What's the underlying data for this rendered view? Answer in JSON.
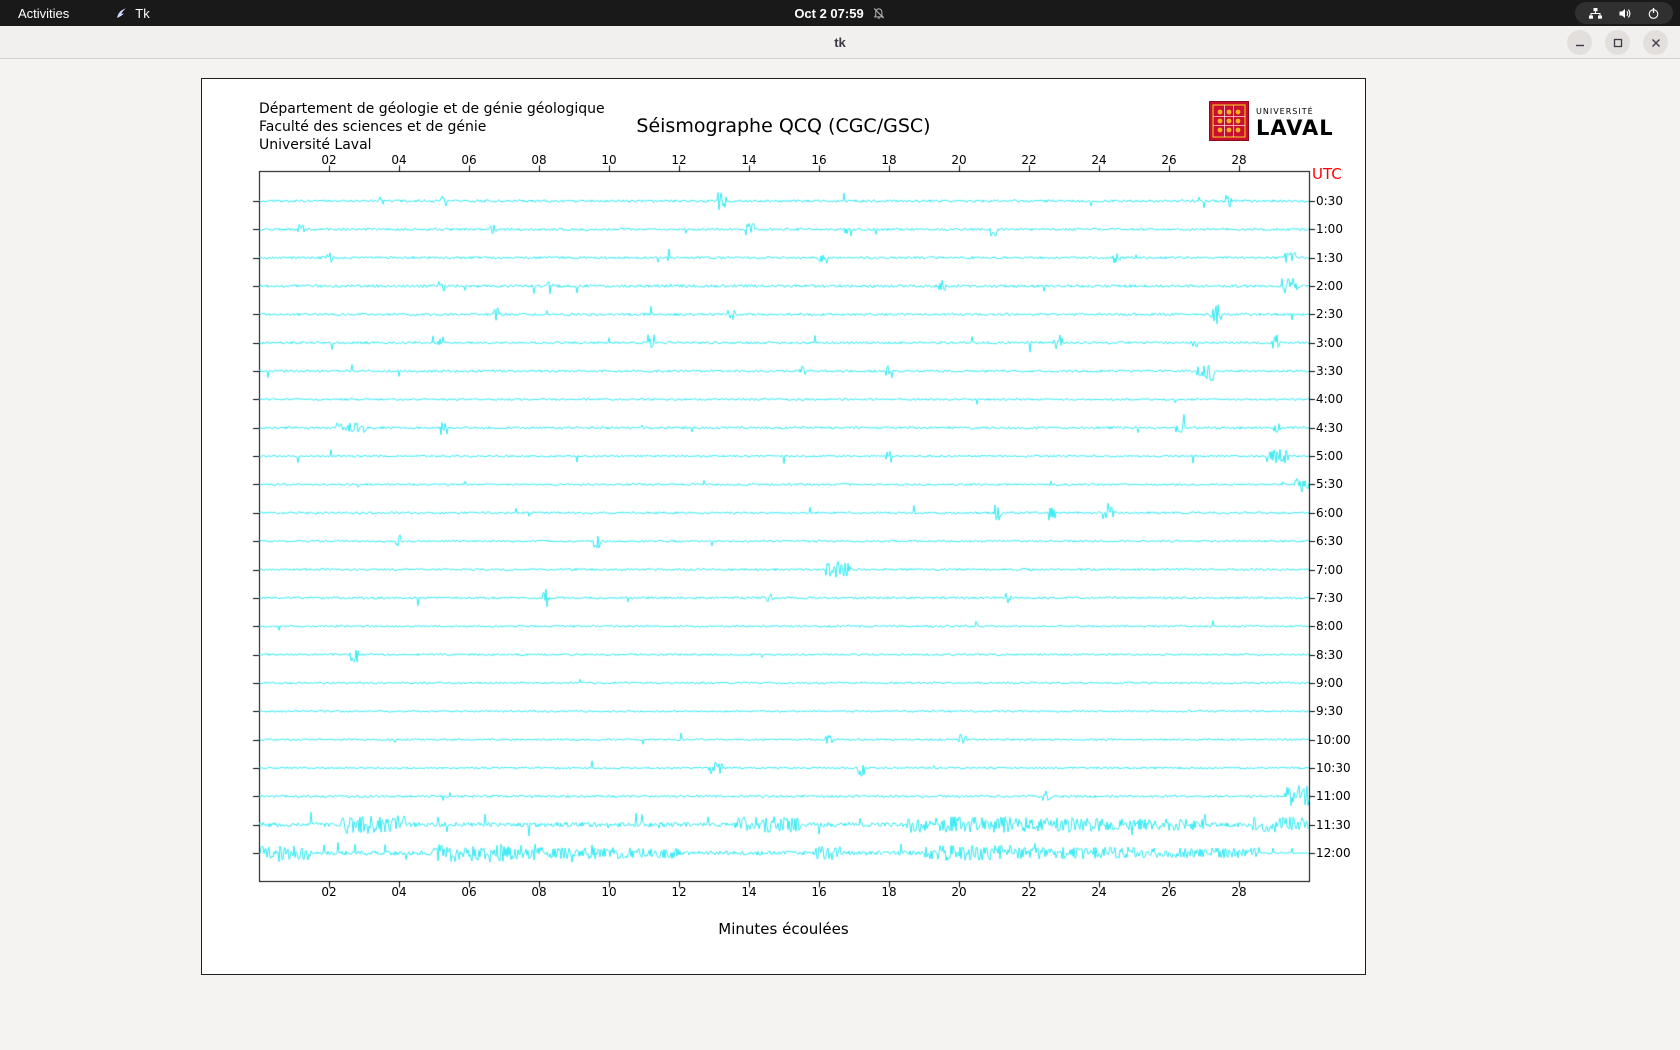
{
  "topbar": {
    "activities": "Activities",
    "app_name": "Tk",
    "clock": "Oct 2  07:59"
  },
  "window": {
    "title": "tk"
  },
  "panel": {
    "header_lines": [
      "Département de géologie et de génie géologique",
      "Faculté des sciences et de génie",
      "Université Laval"
    ],
    "title": "Séismographe QCQ (CGC/GSC)",
    "utc": "UTC",
    "xlabel": "Minutes écoulées",
    "logo": {
      "line1": "UNIVERSITÉ",
      "line2": "LAVAL"
    }
  },
  "colors": {
    "trace": "#00E5F0",
    "utc": "#FF0000",
    "frame": "#000000"
  },
  "chart_data": {
    "type": "line",
    "title": "Séismographe QCQ (CGC/GSC)",
    "xlabel": "Minutes écoulées",
    "x_range": [
      0,
      30
    ],
    "x_ticks": [
      "02",
      "04",
      "06",
      "08",
      "10",
      "12",
      "14",
      "16",
      "18",
      "20",
      "22",
      "24",
      "26",
      "28"
    ],
    "y_axis_label": "UTC",
    "trace_color": "#00E5F0",
    "traces": [
      {
        "label": "0:30",
        "noise": 1.2,
        "spike_rate": 0.004,
        "spike_amp": 7,
        "bursts": [
          [
            13.1,
            13.35,
            10
          ],
          [
            3.4,
            3.55,
            5
          ],
          [
            5.2,
            5.35,
            5
          ],
          [
            27.6,
            27.8,
            6
          ]
        ]
      },
      {
        "label": "1:00",
        "noise": 1.2,
        "spike_rate": 0.004,
        "spike_amp": 6,
        "bursts": [
          [
            1.1,
            1.3,
            5
          ],
          [
            6.6,
            6.8,
            5
          ],
          [
            13.9,
            14.15,
            6
          ],
          [
            20.85,
            21.1,
            8
          ]
        ]
      },
      {
        "label": "1:30",
        "noise": 1.2,
        "spike_rate": 0.004,
        "spike_amp": 6,
        "bursts": [
          [
            1.9,
            2.1,
            5
          ],
          [
            16.0,
            16.2,
            5
          ],
          [
            24.4,
            24.6,
            7
          ],
          [
            29.3,
            29.6,
            6
          ]
        ]
      },
      {
        "label": "2:00",
        "noise": 1.4,
        "spike_rate": 0.005,
        "spike_amp": 6,
        "bursts": [
          [
            5.1,
            5.3,
            6
          ],
          [
            8.2,
            8.4,
            8
          ],
          [
            19.4,
            19.6,
            6
          ],
          [
            29.2,
            29.7,
            8
          ]
        ]
      },
      {
        "label": "2:30",
        "noise": 1.2,
        "spike_rate": 0.004,
        "spike_amp": 6,
        "bursts": [
          [
            6.7,
            6.9,
            8
          ],
          [
            13.4,
            13.6,
            6
          ],
          [
            27.2,
            27.5,
            10
          ]
        ]
      },
      {
        "label": "3:00",
        "noise": 1.2,
        "spike_rate": 0.004,
        "spike_amp": 6,
        "bursts": [
          [
            5.1,
            5.3,
            6
          ],
          [
            11.1,
            11.3,
            9
          ],
          [
            22.7,
            22.95,
            8
          ],
          [
            26.6,
            26.8,
            5
          ],
          [
            28.9,
            29.15,
            8
          ]
        ]
      },
      {
        "label": "3:30",
        "noise": 1.2,
        "spike_rate": 0.004,
        "spike_amp": 6,
        "bursts": [
          [
            15.4,
            15.6,
            8
          ],
          [
            17.9,
            18.1,
            8
          ],
          [
            26.8,
            27.3,
            10
          ]
        ]
      },
      {
        "label": "4:00",
        "noise": 1.0,
        "spike_rate": 0.003,
        "spike_amp": 4
      },
      {
        "label": "4:30",
        "noise": 1.2,
        "spike_rate": 0.004,
        "spike_amp": 5,
        "bursts": [
          [
            2.2,
            3.1,
            5
          ],
          [
            5.2,
            5.4,
            7
          ],
          [
            26.2,
            26.45,
            6
          ],
          [
            29.0,
            29.2,
            5
          ]
        ]
      },
      {
        "label": "5:00",
        "noise": 1.0,
        "spike_rate": 0.003,
        "spike_amp": 5,
        "bursts": [
          [
            17.9,
            18.1,
            7
          ],
          [
            28.8,
            29.4,
            7
          ]
        ]
      },
      {
        "label": "5:30",
        "noise": 1.0,
        "spike_rate": 0.003,
        "spike_amp": 4,
        "bursts": [
          [
            29.6,
            30,
            8
          ]
        ]
      },
      {
        "label": "6:00",
        "noise": 1.1,
        "spike_rate": 0.004,
        "spike_amp": 5,
        "bursts": [
          [
            21.0,
            21.2,
            9
          ],
          [
            22.55,
            22.75,
            8
          ],
          [
            24.1,
            24.45,
            10
          ]
        ]
      },
      {
        "label": "6:30",
        "noise": 1.0,
        "spike_rate": 0.003,
        "spike_amp": 5,
        "bursts": [
          [
            3.85,
            4.05,
            7
          ],
          [
            9.55,
            9.75,
            7
          ]
        ]
      },
      {
        "label": "7:00",
        "noise": 1.1,
        "spike_rate": 0.003,
        "spike_amp": 5,
        "bursts": [
          [
            16.2,
            16.9,
            8
          ]
        ]
      },
      {
        "label": "7:30",
        "noise": 1.1,
        "spike_rate": 0.003,
        "spike_amp": 5,
        "bursts": [
          [
            8.1,
            8.3,
            9
          ],
          [
            14.5,
            14.7,
            6
          ],
          [
            21.3,
            21.5,
            7
          ]
        ]
      },
      {
        "label": "8:00",
        "noise": 1.0,
        "spike_rate": 0.003,
        "spike_amp": 4
      },
      {
        "label": "8:30",
        "noise": 1.0,
        "spike_rate": 0.003,
        "spike_amp": 5,
        "bursts": [
          [
            2.6,
            2.85,
            8
          ]
        ]
      },
      {
        "label": "9:00",
        "noise": 1.0,
        "spike_rate": 0.002,
        "spike_amp": 4
      },
      {
        "label": "9:30",
        "noise": 0.9,
        "spike_rate": 0.002,
        "spike_amp": 4
      },
      {
        "label": "10:00",
        "noise": 1.0,
        "spike_rate": 0.003,
        "spike_amp": 5,
        "bursts": [
          [
            16.2,
            16.4,
            5
          ],
          [
            20.0,
            20.2,
            6
          ]
        ]
      },
      {
        "label": "10:30",
        "noise": 1.0,
        "spike_rate": 0.003,
        "spike_amp": 5,
        "bursts": [
          [
            12.8,
            13.25,
            7
          ],
          [
            17.1,
            17.3,
            8
          ]
        ]
      },
      {
        "label": "11:00",
        "noise": 1.2,
        "spike_rate": 0.004,
        "spike_amp": 5,
        "bursts": [
          [
            22.4,
            22.6,
            6
          ],
          [
            29.3,
            30,
            11
          ]
        ]
      },
      {
        "label": "11:30",
        "noise": 2.3,
        "spike_rate": 0.02,
        "spike_amp": 8,
        "bursts": [
          [
            2.4,
            4.2,
            9
          ],
          [
            13.5,
            15.5,
            8
          ],
          [
            18.5,
            21.5,
            8
          ],
          [
            21.5,
            24.0,
            7
          ],
          [
            24.0,
            27.0,
            6
          ],
          [
            28.4,
            30,
            8
          ]
        ]
      },
      {
        "label": "12:00",
        "noise": 2.1,
        "spike_rate": 0.015,
        "spike_amp": 7,
        "fade_after": 28.5,
        "bursts": [
          [
            0,
            1.5,
            7
          ],
          [
            5.0,
            8.0,
            9
          ],
          [
            8.0,
            12.0,
            6
          ],
          [
            15.9,
            16.6,
            7
          ],
          [
            19.0,
            21.5,
            8
          ],
          [
            21.5,
            25.0,
            6
          ],
          [
            25.0,
            28.5,
            5
          ]
        ]
      }
    ]
  }
}
